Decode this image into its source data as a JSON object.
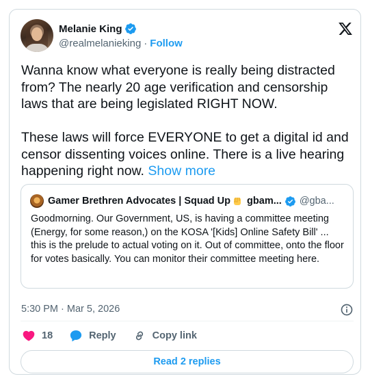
{
  "author": {
    "name": "Melanie King",
    "handle": "@realmelanieking",
    "separator": "·",
    "follow_label": "Follow"
  },
  "tweet": {
    "text": "Wanna know what everyone is really being distracted from? The nearly 20 age verification and censorship laws that are being legislated RIGHT NOW.\n\nThese laws will force EVERYONE to get a digital id and censor dissenting voices online. There is a live hearing happening right now. ",
    "show_more_label": "Show more"
  },
  "quote": {
    "name_prefix": "Gamer Brethren Advocates | Squad Up",
    "name_suffix": " gbam...",
    "handle": "@gba...",
    "text": "Goodmorning. Our Government, US, is having a committee meeting (Energy, for some reason,) on the KOSA '[Kids] Online Safety Bill' ... this is the prelude to actual voting on it. Out of committee, onto the floor for votes basically. You can monitor their committee meeting here."
  },
  "meta": {
    "timestamp": "5:30 PM · Mar 5, 2026"
  },
  "actions": {
    "like_count": "18",
    "reply_label": "Reply",
    "copy_link_label": "Copy link"
  },
  "replies_button": {
    "label": "Read 2 replies"
  },
  "colors": {
    "accent": "#1d9bf0",
    "like": "#f91880",
    "text": "#0f1419",
    "secondary": "#536471",
    "border": "#cfd9de"
  },
  "icons": {
    "verified": "verified-badge-icon",
    "x_logo": "x-logo-icon",
    "info": "info-icon",
    "like": "heart-icon",
    "reply": "speech-bubble-icon",
    "copy_link": "link-icon",
    "emoji": "raised-fist-emoji-icon"
  }
}
